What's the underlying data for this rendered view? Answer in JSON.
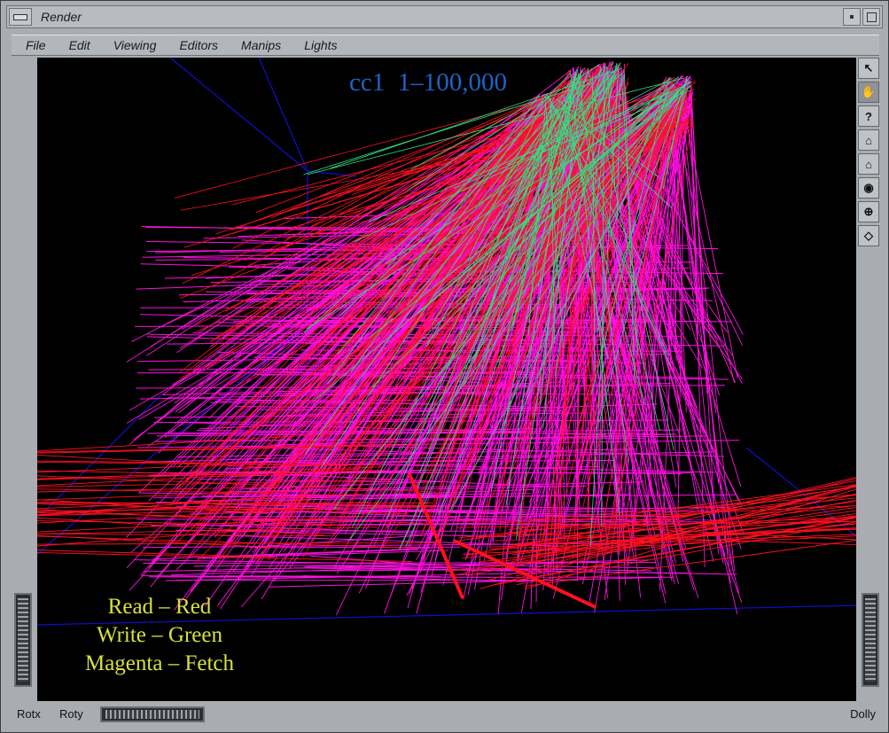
{
  "window": {
    "title": "Render"
  },
  "menubar": {
    "items": [
      "File",
      "Edit",
      "Viewing",
      "Editors",
      "Manips",
      "Lights"
    ]
  },
  "viewer": {
    "title": "cc1  1–100,000",
    "legend": [
      "Read – Red",
      "Write – Green",
      "Magenta – Fetch"
    ]
  },
  "toolbar": {
    "items": [
      {
        "icon": "pointer-arrow-icon",
        "glyph": "↖"
      },
      {
        "icon": "hand-icon",
        "glyph": "✋"
      },
      {
        "icon": "help-icon",
        "glyph": "?"
      },
      {
        "icon": "home-icon",
        "glyph": "⌂"
      },
      {
        "icon": "set-home-icon",
        "glyph": "⌂"
      },
      {
        "icon": "view-all-icon",
        "glyph": "◉"
      },
      {
        "icon": "seek-icon",
        "glyph": "⊕"
      },
      {
        "icon": "projection-icon",
        "glyph": "◇"
      }
    ]
  },
  "bottom": {
    "rotx": "Rotx",
    "roty": "Roty",
    "dolly": "Dolly"
  },
  "colors": {
    "read": "#ff1020",
    "write": "#30e080",
    "fetch": "#ff10e0",
    "axes": "#1010d0",
    "title": "#1e63c8",
    "legend": "#d8e23a"
  }
}
